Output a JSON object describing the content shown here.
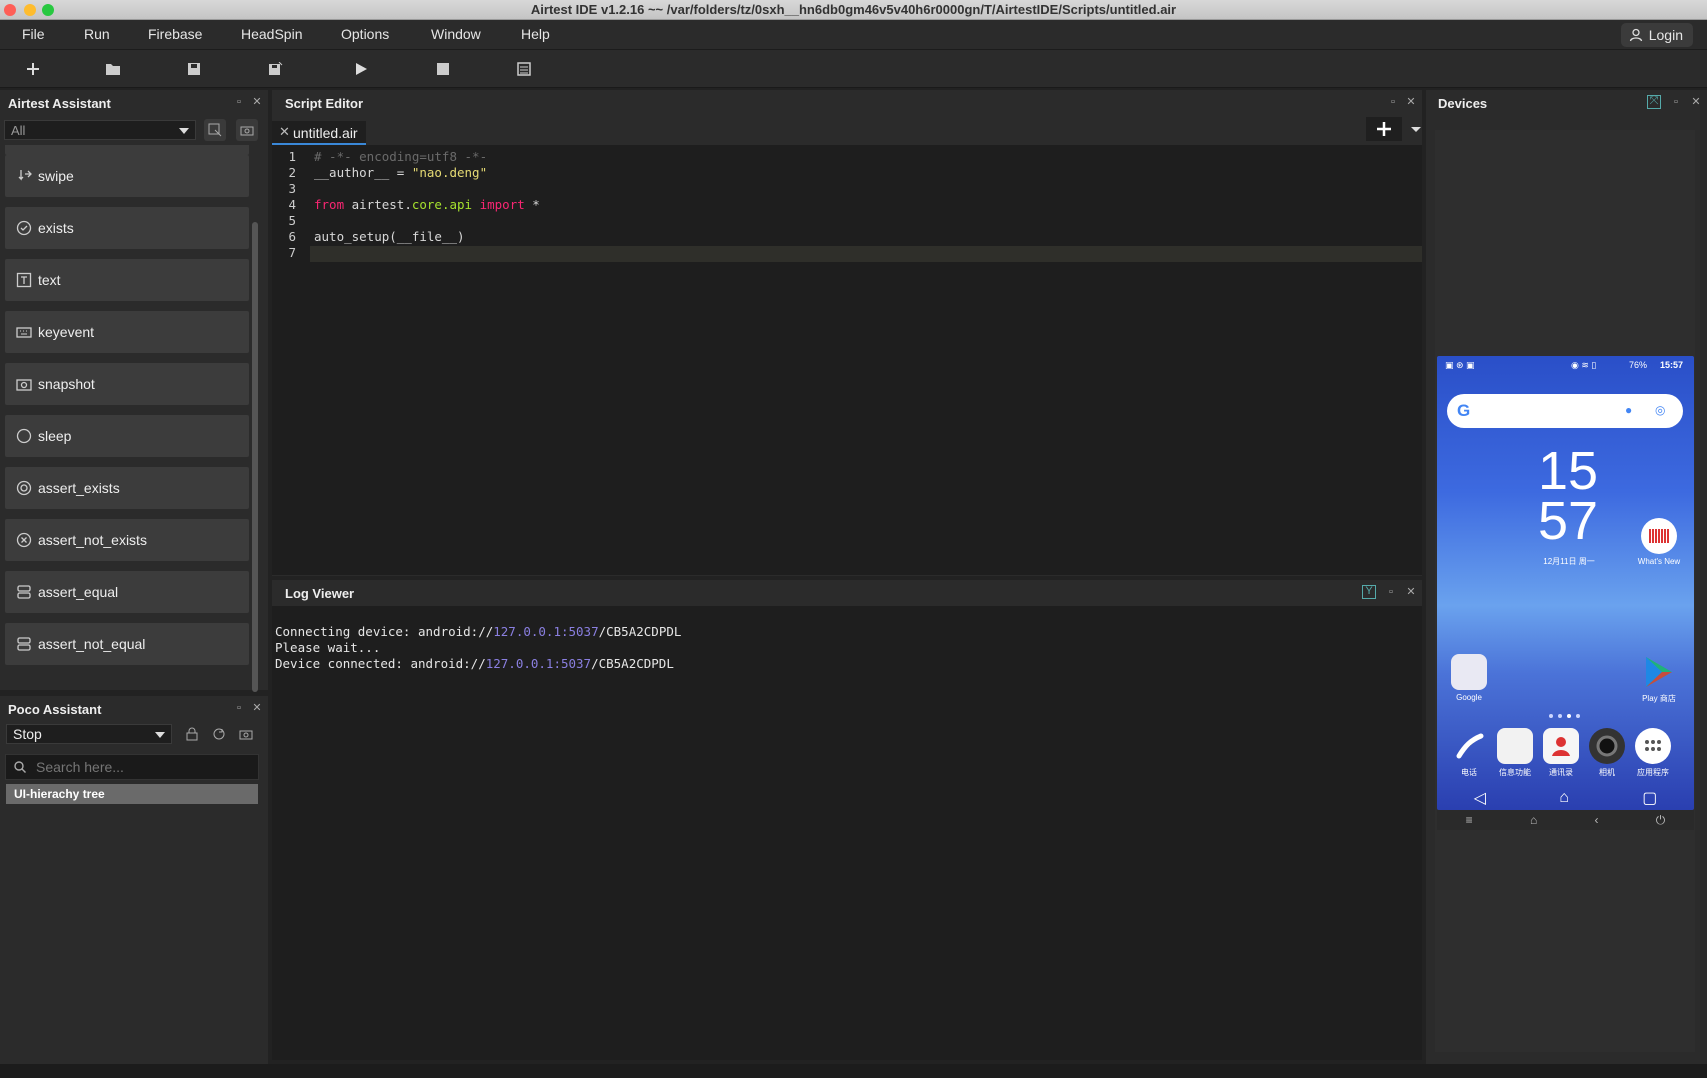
{
  "window": {
    "title": "Airtest IDE v1.2.16 ~~ /var/folders/tz/0sxh__hn6db0gm46v5v40h6r0000gn/T/AirtestIDE/Scripts/untitled.air"
  },
  "menu": {
    "items": [
      "File",
      "Run",
      "Firebase",
      "HeadSpin",
      "Options",
      "Window",
      "Help"
    ],
    "login_label": "Login"
  },
  "airtest_assistant": {
    "title": "Airtest Assistant",
    "filter_value": "All",
    "items": [
      {
        "label": "swipe",
        "icon": "swipe-icon"
      },
      {
        "label": "exists",
        "icon": "check-circle-icon"
      },
      {
        "label": "text",
        "icon": "text-box-icon"
      },
      {
        "label": "keyevent",
        "icon": "keyboard-icon"
      },
      {
        "label": "snapshot",
        "icon": "camera-icon"
      },
      {
        "label": "sleep",
        "icon": "moon-icon"
      },
      {
        "label": "assert_exists",
        "icon": "target-icon"
      },
      {
        "label": "assert_not_exists",
        "icon": "x-circle-icon"
      },
      {
        "label": "assert_equal",
        "icon": "stack-icon"
      },
      {
        "label": "assert_not_equal",
        "icon": "stack-icon"
      }
    ]
  },
  "poco_assistant": {
    "title": "Poco Assistant",
    "mode_value": "Stop",
    "search_placeholder": "Search here...",
    "tree_label": "UI-hierachy tree"
  },
  "script_editor": {
    "title": "Script Editor",
    "tab_label": "untitled.air",
    "line_numbers": [
      "1",
      "2",
      "3",
      "4",
      "5",
      "6",
      "7"
    ],
    "line1": "# -*- encoding=utf8 -*-",
    "line2_a": "__author__ = ",
    "line2_b": "\"nao.deng\"",
    "line4_a": "from",
    "line4_b": " airtest.",
    "line4_c": "core.api",
    "line4_d": " import",
    "line4_e": " *",
    "line6": "auto_setup(__file__)"
  },
  "log_viewer": {
    "title": "Log Viewer",
    "line1_prefix": "Connecting device: android://",
    "line1_ip": "127.0.0.1:5037",
    "line1_suffix": "/CB5A2CDPDL",
    "line2": "Please wait...",
    "line3_prefix": "Device connected: android://",
    "line3_ip": "127.0.0.1:5037",
    "line3_suffix": "/CB5A2CDPDL"
  },
  "devices": {
    "title": "Devices",
    "phone": {
      "status_time": "15:57",
      "battery": "76%",
      "clock_hour": "15",
      "clock_min": "57",
      "date": "12月11日 周一",
      "whats_new_label": "What's New",
      "folder_label": "Google",
      "play_label": "Play 商店",
      "dock": [
        "电话",
        "信息功能",
        "通讯录",
        "相机",
        "应用程序"
      ]
    }
  },
  "colors": {
    "accent": "#3a88d8",
    "keyword": "#f92672",
    "string": "#e6db74",
    "module": "#a6e22e",
    "log_ip": "#8a7fe0"
  }
}
